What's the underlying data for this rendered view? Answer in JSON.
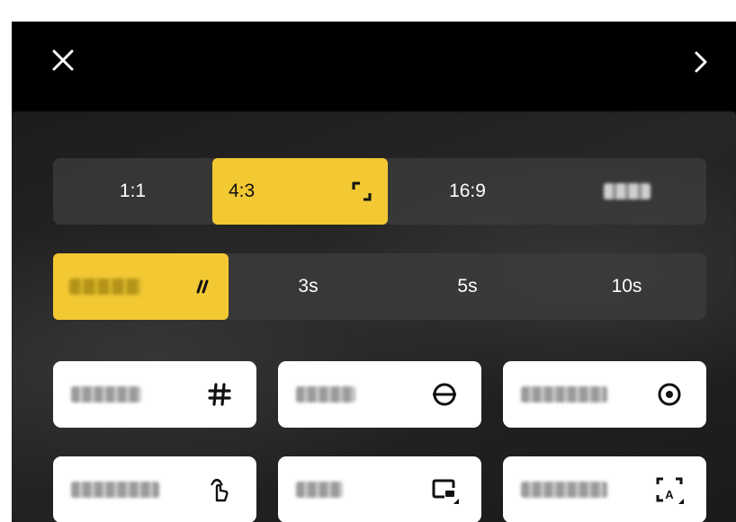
{
  "header": {
    "close_icon": "close-icon",
    "right_label": "",
    "chevron_icon": "chevron-right-icon"
  },
  "aspect_ratios": {
    "options": [
      "1:1",
      "4:3",
      "16:9",
      ""
    ],
    "selected": "4:3",
    "selected_icon": "crop-corners-icon"
  },
  "timer": {
    "options": [
      "",
      "3s",
      "5s",
      "10s"
    ],
    "selected_index": 0,
    "selected_icon": "timer-mark-icon"
  },
  "tools": [
    {
      "label": "",
      "icon": "grid-icon"
    },
    {
      "label": "",
      "icon": "level-icon"
    },
    {
      "label": "",
      "icon": "capture-circle-icon"
    },
    {
      "label": "",
      "icon": "gesture-hand-icon"
    },
    {
      "label": "",
      "icon": "subtitle-icon"
    },
    {
      "label": "",
      "icon": "scan-text-icon"
    }
  ],
  "colors": {
    "accent": "#f2c833",
    "panel_bg": "#000000",
    "segment_bg": "#3c3c3c",
    "tile_bg": "#ffffff"
  }
}
